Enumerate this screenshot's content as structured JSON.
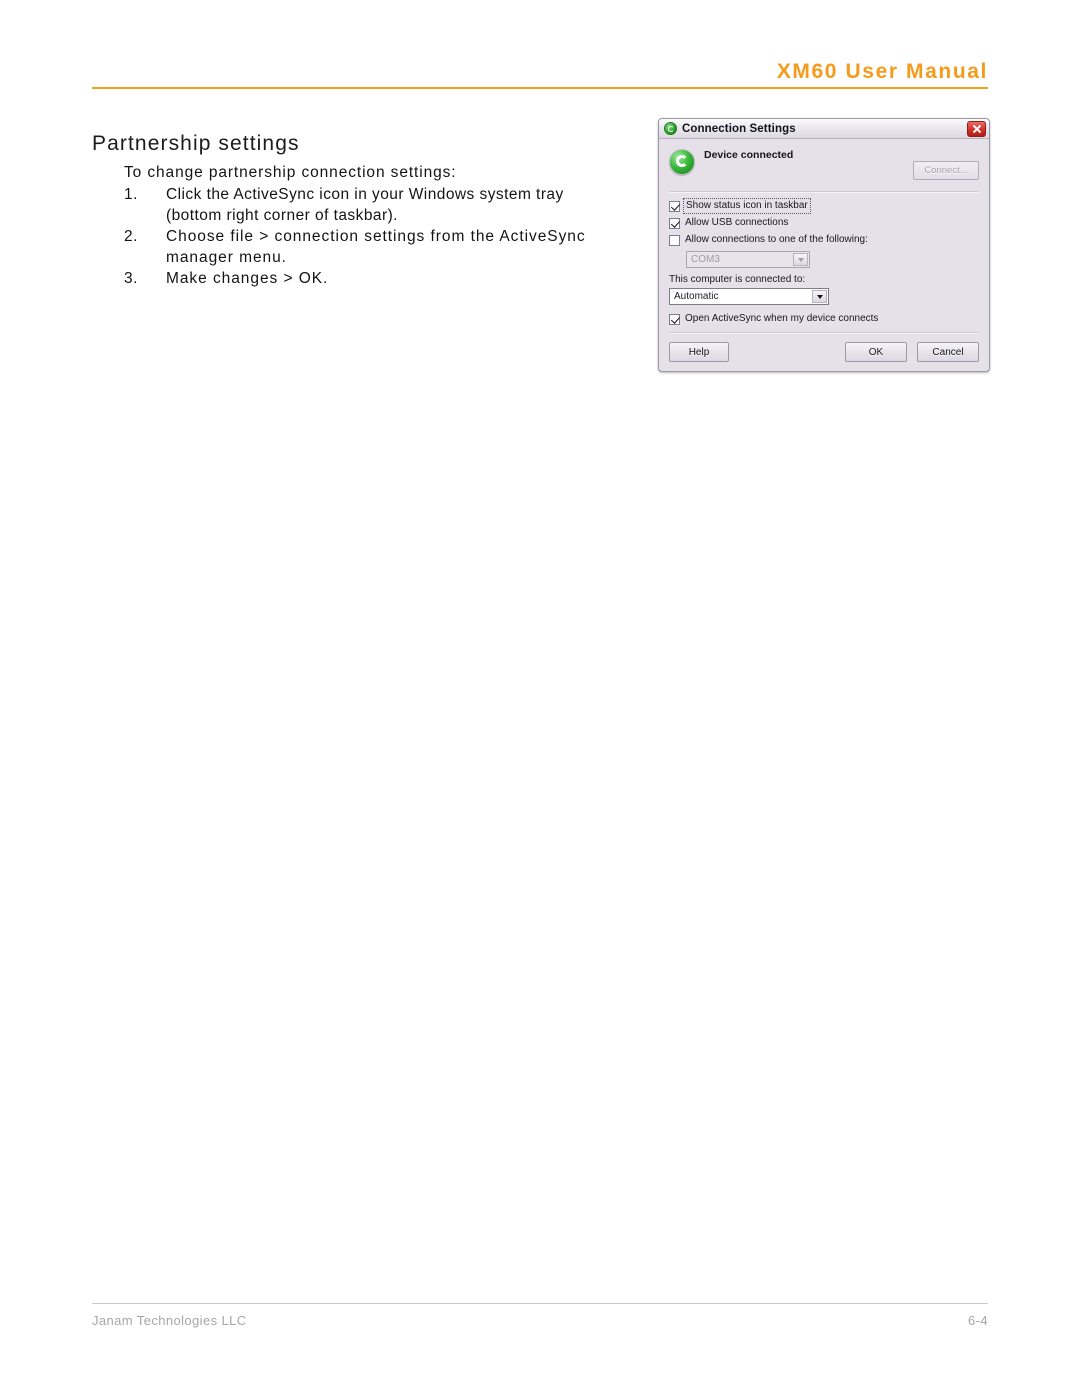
{
  "header": {
    "manual_title": "XM60 User Manual",
    "rule_color": "#f0a01e"
  },
  "section": {
    "heading": "Partnership settings",
    "intro": "To change partnership connection settings:",
    "steps": [
      {
        "number": "1.",
        "lines": [
          "Click the ActiveSync icon in your Windows system tray",
          "(bottom right corner of taskbar)."
        ]
      },
      {
        "number": "2.",
        "lines": [
          "Choose file > connection settings from the ActiveSync",
          "manager menu."
        ]
      },
      {
        "number": "3.",
        "lines": [
          "Make changes > OK."
        ]
      }
    ]
  },
  "dialog": {
    "title": "Connection Settings",
    "title_icon": "activesync-icon",
    "close_icon": "close-icon",
    "status_icon": "activesync-sync-icon",
    "status_text": "Device connected",
    "connect_button": "Connect...",
    "connect_button_enabled": false,
    "checkboxes": [
      {
        "label": "Show status icon in taskbar",
        "checked": true,
        "enabled": true,
        "focused": true
      },
      {
        "label": "Allow USB connections",
        "checked": true,
        "enabled": true,
        "focused": false
      },
      {
        "label": "Allow connections to one of the following:",
        "checked": false,
        "enabled": true,
        "focused": false
      }
    ],
    "com_port": {
      "value": "COM3",
      "enabled": false
    },
    "connected_to_label": "This computer is connected to:",
    "connected_to": {
      "value": "Automatic",
      "enabled": true
    },
    "open_activesync": {
      "label": "Open ActiveSync when my device connects",
      "checked": true
    },
    "buttons": {
      "help": "Help",
      "ok": "OK",
      "cancel": "Cancel"
    },
    "background_color": "#e6e1e8"
  },
  "footer": {
    "company": "Janam Technologies LLC",
    "page_number": "6-4"
  }
}
